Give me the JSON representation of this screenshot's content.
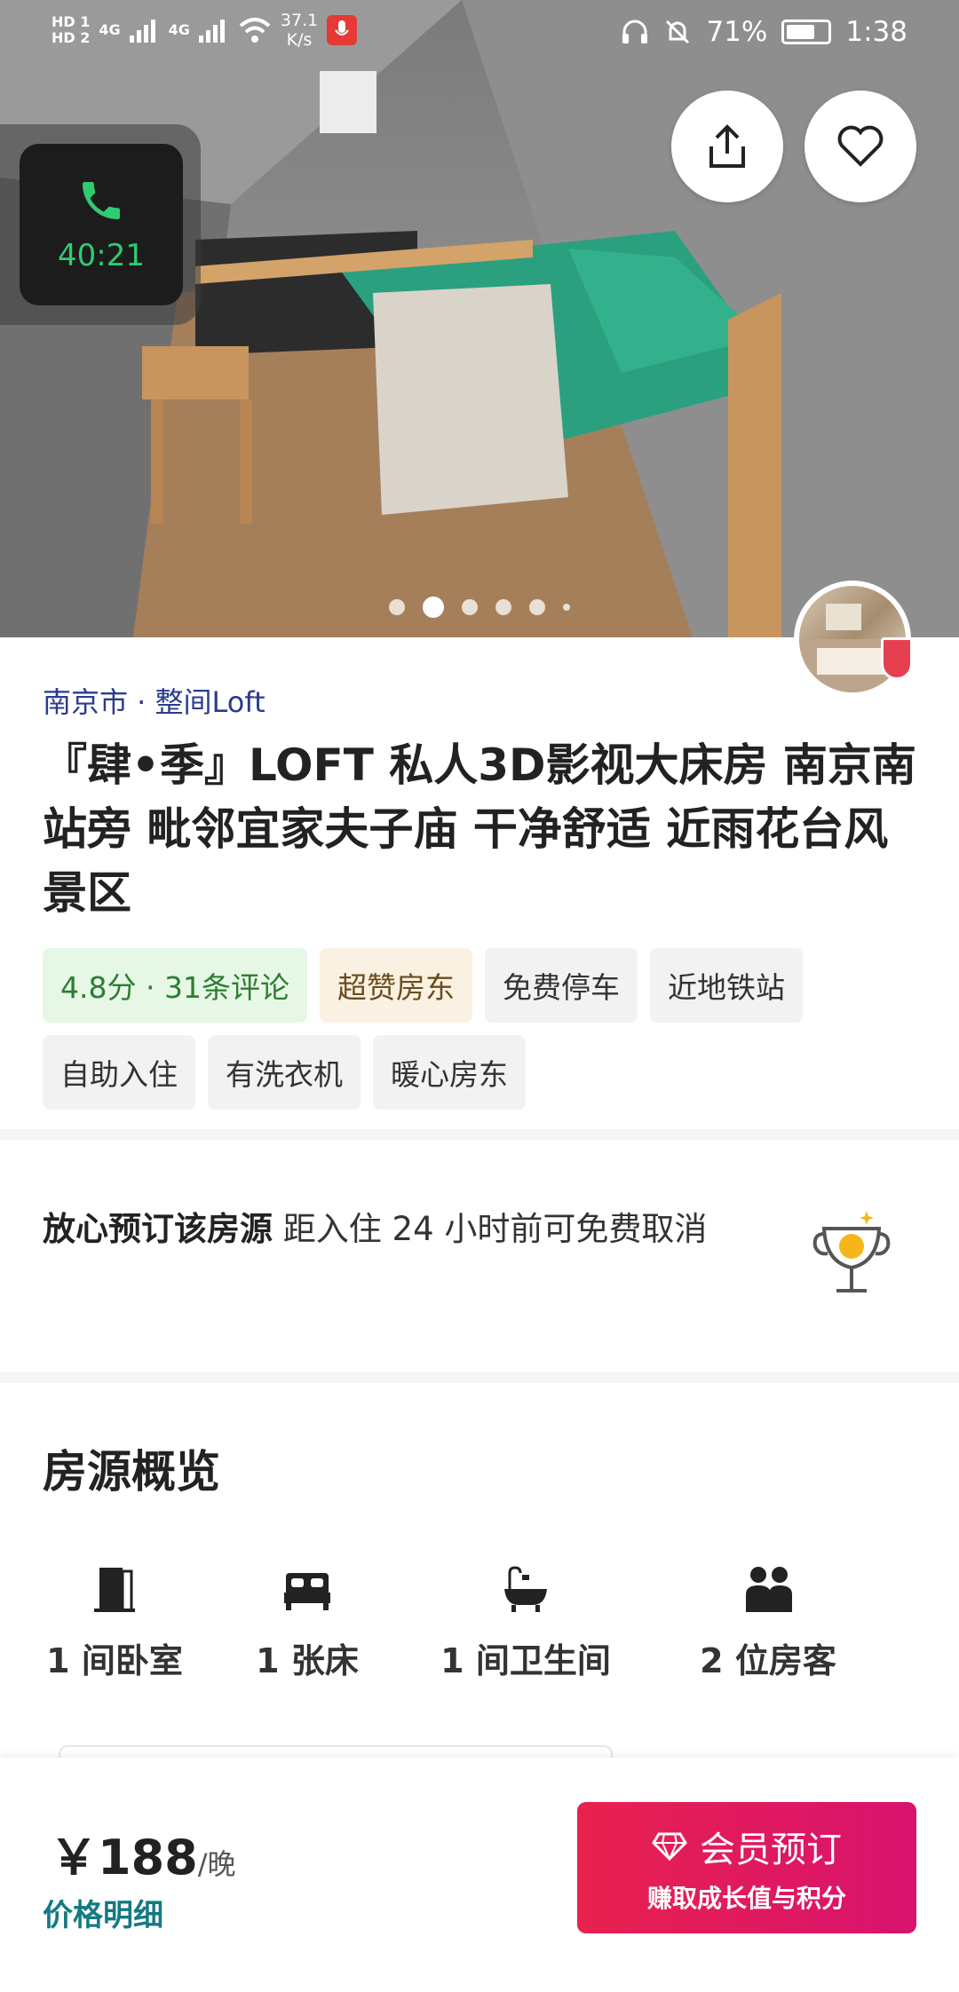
{
  "status_bar": {
    "hd1": "HD 1",
    "hd2": "HD 2",
    "net1": "4G",
    "net2": "4G",
    "speed_value": "37.1",
    "speed_unit": "K/s",
    "battery_pct": "71%",
    "time": "1:38",
    "battery_level": 0.71
  },
  "call": {
    "duration": "40:21"
  },
  "gallery": {
    "dot_count": 6,
    "active_index": 1
  },
  "listing": {
    "location": "南京市 · 整间Loft",
    "title": "『肆•季』LOFT 私人3D影视大床房 南京南站旁 毗邻宜家夫子庙 干净舒适 近雨花台风景区",
    "tags": [
      "4.8分 · 31条评论",
      "超赞房东",
      "免费停车",
      "近地铁站",
      "自助入住",
      "有洗衣机",
      "暖心房东"
    ]
  },
  "booking": {
    "bold": "放心预订该房源",
    "text": " 距入住 24 小时前可免费取消"
  },
  "overview": {
    "title": "房源概览",
    "items": [
      {
        "icon": "door-icon",
        "label": "1 间卧室"
      },
      {
        "icon": "bed-icon",
        "label": "1 张床"
      },
      {
        "icon": "bathtub-icon",
        "label": "1 间卫生间"
      },
      {
        "icon": "guests-icon",
        "label": "2 位房客"
      }
    ]
  },
  "bottom": {
    "price": "￥188",
    "unit": "/晚",
    "detail": "价格明细",
    "book_label": "会员预订",
    "book_sub": "赚取成长值与积分"
  }
}
